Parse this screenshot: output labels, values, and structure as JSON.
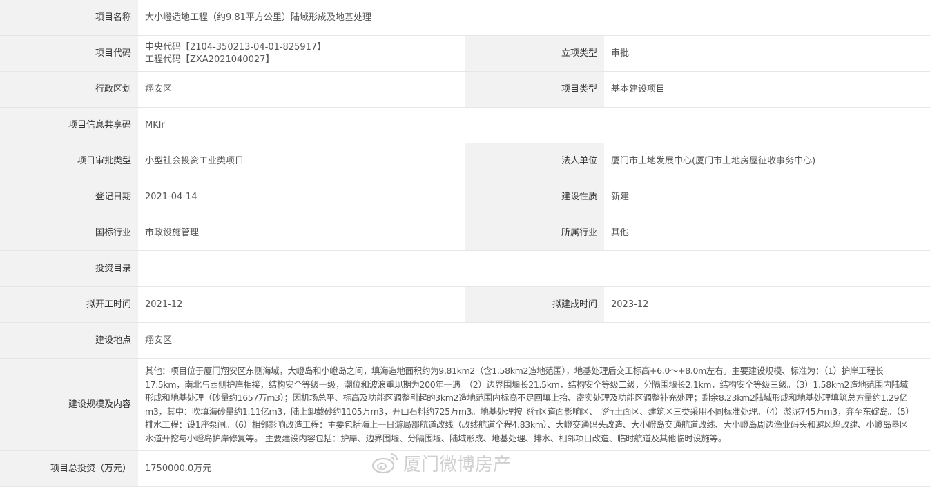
{
  "project": {
    "name_label": "项目名称",
    "name_value": "大小嶝造地工程（约9.81平方公里）陆域形成及地基处理",
    "code_label": "项目代码",
    "code_central": "中央代码【2104-350213-04-01-825917】",
    "code_engineering": "工程代码【ZXA2021040027】",
    "approval_label": "立项类型",
    "approval_value": "审批",
    "district_label": "行政区划",
    "district_value": "翔安区",
    "type_label": "项目类型",
    "type_value": "基本建设项目",
    "share_code_label": "项目信息共享码",
    "share_code_value": "MKlr",
    "review_type_label": "项目审批类型",
    "review_type_value": "小型社会投资工业类项目",
    "legal_label": "法人单位",
    "legal_value": "厦门市土地发展中心(厦门市土地房屋征收事务中心)",
    "reg_date_label": "登记日期",
    "reg_date_value": "2021-04-14",
    "nature_label": "建设性质",
    "nature_value": "新建",
    "industry_label": "国标行业",
    "industry_value": "市政设施管理",
    "sector_label": "所属行业",
    "sector_value": "其他",
    "catalog_label": "投资目录",
    "catalog_value": "",
    "start_label": "拟开工时间",
    "start_value": "2021-12",
    "finish_label": "拟建成时间",
    "finish_value": "2023-12",
    "location_label": "建设地点",
    "location_value": "翔安区",
    "scale_label": "建设规模及内容",
    "scale_value": "其他：项目位于厦门翔安区东侧海域，大嶝岛和小嶝岛之间，填海造地面积约为9.81km2（含1.58km2造地范围），地基处理后交工标高+6.0～+8.0m左右。主要建设规模、标准为：（1）护岸工程长17.5km，南北与西侧护岸相接，结构安全等级一级，潮位和波浪重现期为200年一遇。（2）边界围堰长21.5km，结构安全等级二级，分隔围堰长2.1km，结构安全等级三级。（3）1.58km2造地范围内陆域形成和地基处理（砂量约1657万m3）；因机场总平、标高及功能区调整引起的3km2造地范围内标高不足回填上抬、密实处理及功能区调整补充处理；剩余8.23km2陆域形成和地基处理填筑总方量约1.29亿m3，其中：吹填海砂量约1.11亿m3，陆上卸载砂约1105万m3，开山石料约725万m3。地基处理按飞行区道面影响区、飞行土面区、建筑区三类采用不同标准处理。（4）淤泥745万m3，弃至东碇岛。（5）排水工程：设1座泵闸。（6）相邻影响改造工程：主要包括海上一日游局部航道改线（改线航道全程4.83km）、大嶝交通码头改造、大小嶝岛交通航道改线、大小嶝岛周边渔业码头和避风坞改建、小嶝岛垦区水道开挖与小嶝岛护岸修复等。 主要建设内容包括：护岸、边界围堰、分隔围堰、陆域形成、地基处理、排水、相邻项目改造、临时航道及其他临时设施等。",
    "investment_label": "项目总投资（万元）",
    "investment_value": "1750000.0万元"
  },
  "watermark": {
    "text": "厦门微博房产",
    "icon": "weibo-icon"
  }
}
